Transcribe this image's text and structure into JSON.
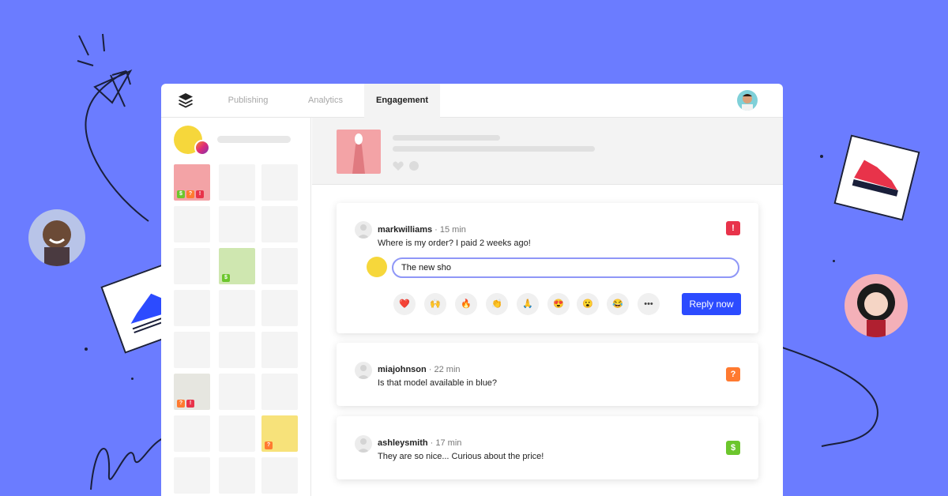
{
  "nav": {
    "tabs": [
      {
        "label": "Publishing",
        "active": false
      },
      {
        "label": "Analytics",
        "active": false
      },
      {
        "label": "Engagement",
        "active": true
      }
    ]
  },
  "badges": {
    "money": "$",
    "question": "?",
    "alert": "!"
  },
  "comments": [
    {
      "user": "markwilliams",
      "time": "· 15 min",
      "text": "Where is my order? I paid 2 weeks ago!",
      "flag": "!",
      "flag_color": "#e8334a"
    },
    {
      "user": "miajohnson",
      "time": "· 22 min",
      "text": "Is that model available in blue?",
      "flag": "?",
      "flag_color": "#ff7a30"
    },
    {
      "user": "ashleysmith",
      "time": "· 17 min",
      "text": "They are so nice... Curious about the price!",
      "flag": "$",
      "flag_color": "#6cc62c"
    }
  ],
  "reply": {
    "input_value": "The new sho",
    "button_label": "Reply now",
    "emojis": [
      "❤️",
      "🙌",
      "🔥",
      "👏",
      "🙏",
      "😍",
      "😮",
      "😂",
      "•••"
    ]
  },
  "colors": {
    "background": "#6b7cff",
    "accent": "#2c4bff",
    "alert": "#e8334a",
    "question": "#ff7a30",
    "money": "#6cc62c"
  }
}
